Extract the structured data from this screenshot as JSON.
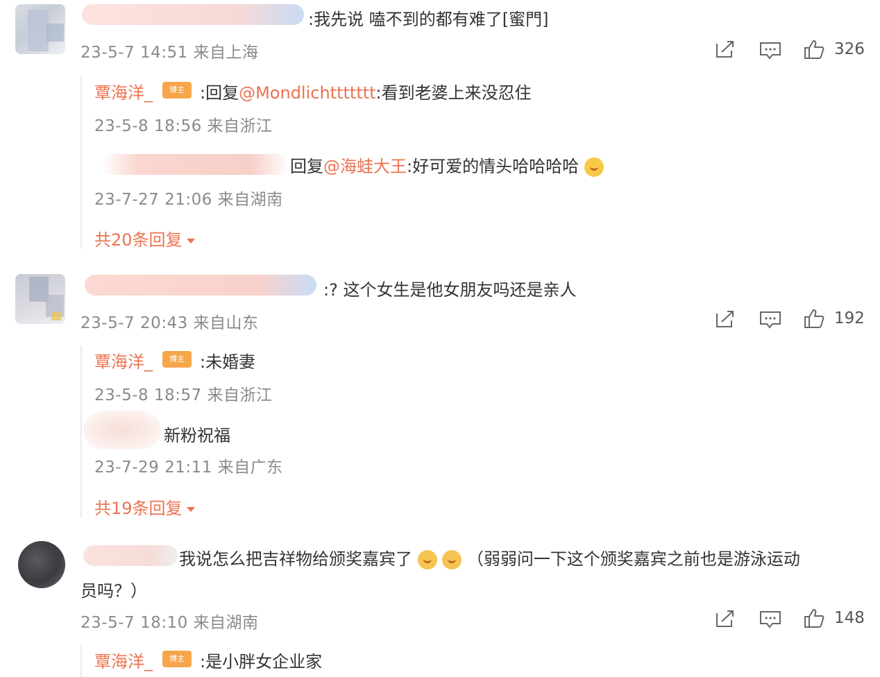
{
  "comments": [
    {
      "text": ":我先说 嗑不到的都有难了[蜜門]",
      "time": "23-5-7 14:51 来自上海",
      "likes": "326",
      "replies": [
        {
          "author": "覃海洋_",
          "badge": "博主",
          "prefix": ":回复",
          "mention": "@Mondlichttttttt",
          "text": ":看到老婆上来没忍住",
          "time": "23-5-8 18:56 来自浙江"
        },
        {
          "prefix": "回复",
          "mention": "@海蛙大王",
          "text": ":好可爱的情头哈哈哈哈",
          "time": "23-7-27 21:06 来自湖南"
        }
      ],
      "more": "共20条回复"
    },
    {
      "text": ":? 这个女生是他女朋友吗还是亲人",
      "time": "23-5-7 20:43 来自山东",
      "likes": "192",
      "replies": [
        {
          "author": "覃海洋_",
          "badge": "博主",
          "text": ":未婚妻",
          "time": "23-5-8 18:57 来自浙江"
        },
        {
          "text": "新粉祝福",
          "time": "23-7-29 21:11 来自广东"
        }
      ],
      "more": "共19条回复"
    },
    {
      "text_a": "我说怎么把吉祥物给颁奖嘉宾了",
      "text_b": "（弱弱问一下这个颁奖嘉宾之前也是游泳运动",
      "text_c": "员吗？）",
      "time": "23-5-7 18:10 来自湖南",
      "likes": "148",
      "replies": [
        {
          "author": "覃海洋_",
          "badge": "博主",
          "text": ":是小胖女企业家"
        }
      ]
    }
  ],
  "icons": {
    "share": "share-icon",
    "comment": "comment-icon",
    "like": "thumbs-up-icon"
  },
  "colors": {
    "accent": "#eb7350",
    "badge": "#f6a54b",
    "meta": "#8a8a8a"
  }
}
